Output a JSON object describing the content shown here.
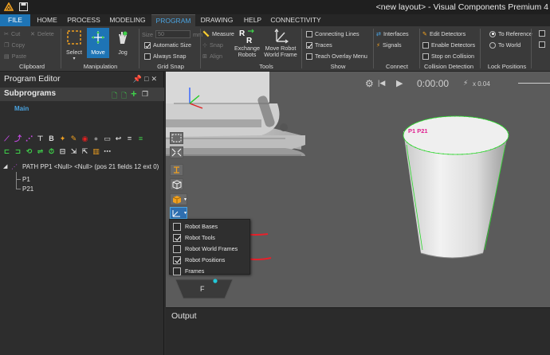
{
  "app": {
    "title": "<new layout> - Visual Components Premium 4"
  },
  "tabs": [
    "FILE",
    "HOME",
    "PROCESS",
    "MODELING",
    "PROGRAM",
    "DRAWING",
    "HELP",
    "CONNECTIVITY"
  ],
  "active_tab": "PROGRAM",
  "ribbon": {
    "clipboard": {
      "cut": "Cut",
      "delete": "Delete",
      "copy": "Copy",
      "paste": "Paste",
      "label": "Clipboard"
    },
    "manipulation": {
      "select": "Select",
      "move": "Move",
      "jog": "Jog",
      "label": "Manipulation"
    },
    "grid_snap": {
      "size_label": "Size",
      "size_value": "50",
      "size_unit": "mm",
      "automatic_size": "Automatic Size",
      "always_snap": "Always Snap",
      "label": "Grid Snap"
    },
    "snap": {
      "measure": "Measure",
      "snap": "Snap",
      "align": "Align"
    },
    "tools": {
      "exchange_robots": "Exchange Robots",
      "move_robot_world_frame": "Move Robot World Frame",
      "label": "Tools"
    },
    "show": {
      "connecting_lines": "Connecting Lines",
      "traces": "Traces",
      "teach_overlay_menu": "Teach Overlay Menu",
      "label": "Show"
    },
    "connect": {
      "interfaces": "Interfaces",
      "signals": "Signals",
      "label": "Connect"
    },
    "collision": {
      "edit_detectors": "Edit Detectors",
      "enable_detectors": "Enable Detectors",
      "stop_on_collision": "Stop on Collision",
      "label": "Collision Detection"
    },
    "lock_positions": {
      "to_reference": "To Reference",
      "to_world": "To World",
      "label": "Lock Positions"
    }
  },
  "program_editor": {
    "title": "Program Editor",
    "subprograms_title": "Subprograms",
    "main_label": "Main",
    "path_label": "PATH PP1 <Null> <Null> (pos 21 fields 12 ext 0)",
    "points": [
      "P1",
      "P21"
    ]
  },
  "viewport": {
    "timer": "0:00:00",
    "zoom": "x 0.04",
    "point_label": "P1 P21",
    "face_label": "F",
    "visibility_menu": [
      {
        "label": "Robot Bases",
        "checked": false
      },
      {
        "label": "Robot Tools",
        "checked": true
      },
      {
        "label": "Robot World Frames",
        "checked": false
      },
      {
        "label": "Robot Positions",
        "checked": true
      },
      {
        "label": "Frames",
        "checked": false
      }
    ]
  },
  "output": {
    "title": "Output"
  },
  "colors": {
    "accent": "#1e74b5",
    "active_tab_text": "#4aa3e0",
    "annotation": "#e8202a",
    "path_point": "#22cc22"
  }
}
